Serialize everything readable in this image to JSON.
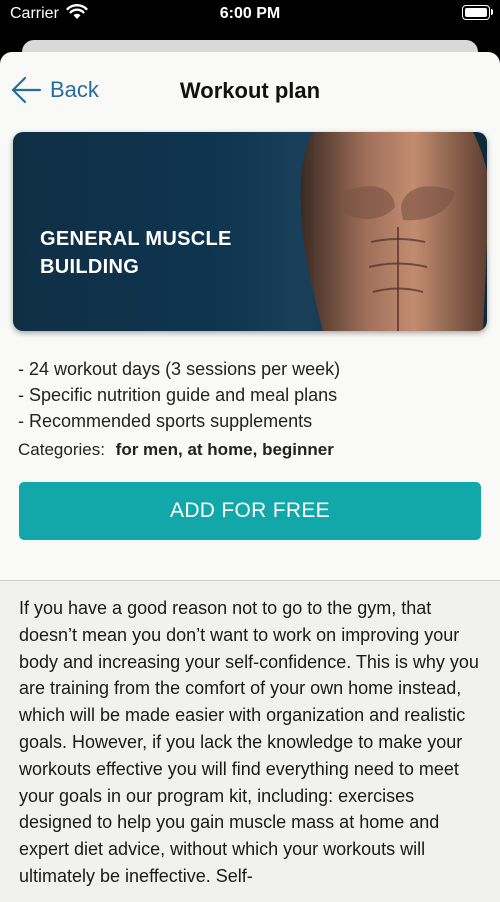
{
  "status_bar": {
    "carrier": "Carrier",
    "time": "6:00 PM",
    "icons": [
      "wifi-icon",
      "battery-icon"
    ]
  },
  "nav": {
    "back_label": "Back",
    "title": "Workout plan",
    "back_icon": "arrow-left-icon",
    "accent_color": "#256e9c"
  },
  "hero": {
    "title_line1": "GENERAL MUSCLE",
    "title_line2": "BUILDING"
  },
  "features": [
    "- 24 workout days (3 sessions per week)",
    "- Specific nutrition guide and meal plans",
    "- Recommended sports supplements"
  ],
  "categories": {
    "label": "Categories:",
    "values": "for men, at home, beginner"
  },
  "add_button": {
    "label": "ADD FOR FREE",
    "color": "#12a7a9"
  },
  "description": "If you have a good reason not to go to the gym, that doesn’t mean you don’t want to work on improving your body and increasing your self-confidence. This is why you are training from the comfort of your own home instead, which will be made easier with organization and realistic goals.  However, if you lack the knowledge to make your workouts effective you will find everything need to meet your goals in our program kit, including: exercises designed to help you gain muscle mass at home and expert diet advice, without which your workouts will ultimately be ineffective. Self-"
}
